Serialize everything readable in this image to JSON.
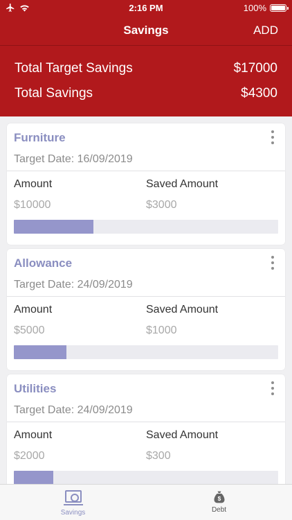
{
  "status_bar": {
    "time": "2:16 PM",
    "battery": "100%"
  },
  "nav": {
    "title": "Savings",
    "add_label": "ADD"
  },
  "summary": {
    "target_label": "Total Target Savings",
    "target_value": "$17000",
    "saved_label": "Total Savings",
    "saved_value": "$4300"
  },
  "cards": [
    {
      "title": "Furniture",
      "target_date": "Target Date: 16/09/2019",
      "amount_label": "Amount",
      "amount_value": "$10000",
      "saved_label": "Saved Amount",
      "saved_value": "$3000",
      "progress": 0.3
    },
    {
      "title": "Allowance",
      "target_date": "Target Date: 24/09/2019",
      "amount_label": "Amount",
      "amount_value": "$5000",
      "saved_label": "Saved Amount",
      "saved_value": "$1000",
      "progress": 0.2
    },
    {
      "title": "Utilities",
      "target_date": "Target Date: 24/09/2019",
      "amount_label": "Amount",
      "amount_value": "$2000",
      "saved_label": "Saved Amount",
      "saved_value": "$300",
      "progress": 0.15
    }
  ],
  "tabs": [
    {
      "label": "Savings",
      "icon": "cash-icon",
      "active": true
    },
    {
      "label": "Debt",
      "icon": "money-bag-icon",
      "active": false
    }
  ],
  "colors": {
    "brand": "#b1191c",
    "accent": "#8a8ec0",
    "progress": "#9596cb"
  }
}
